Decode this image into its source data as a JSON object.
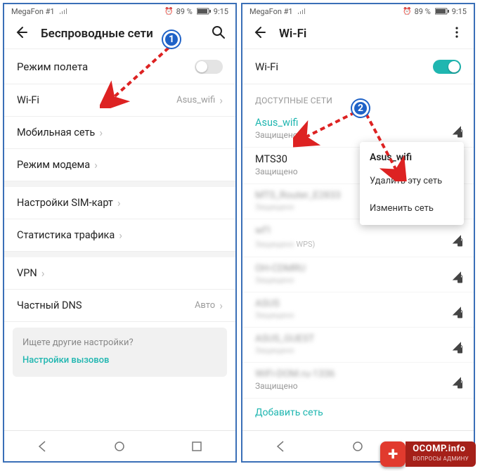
{
  "status": {
    "carrier": "MegaFon #1",
    "battery_pct": "89 %",
    "time": "9:15",
    "alarm_icon": "⏰"
  },
  "left": {
    "title": "Беспроводные сети",
    "rows": {
      "airplane": "Режим полета",
      "wifi": "Wi-Fi",
      "wifi_value": "Asus_wifi",
      "mobile": "Мобильная сеть",
      "tether": "Режим модема",
      "sim": "Настройки SIM-карт",
      "traffic": "Статистика трафика",
      "vpn": "VPN",
      "dns": "Частный DNS",
      "dns_value": "Авто"
    },
    "hint": {
      "q": "Ищете другие настройки?",
      "link": "Настройки вызовов"
    }
  },
  "right": {
    "title": "Wi-Fi",
    "wifi_toggle_label": "Wi-Fi",
    "section": "ДОСТУПНЫЕ СЕТИ",
    "networks": [
      {
        "name": "Asus_wifi",
        "sub": "Защищено",
        "active": true
      },
      {
        "name": "MTS30",
        "sub": "Защищено",
        "active": false
      },
      {
        "name": "MTS_Router_E2833",
        "sub": "Защищено",
        "active": false,
        "blur": true
      },
      {
        "name": "wf1",
        "sub": "Защищено WPS)",
        "active": false,
        "blur": true,
        "wps": " WPS)"
      },
      {
        "name": "OH-CDMRU",
        "sub": "Защищено",
        "active": false,
        "blur": true
      },
      {
        "name": "ASUS",
        "sub": "Защищено",
        "active": false,
        "blur": true
      },
      {
        "name": "ASUS_GUEST",
        "sub": "Защищено",
        "active": false,
        "blur": true
      },
      {
        "name": "WiFi-DOM.ru-1336",
        "sub": "Защищено",
        "active": false,
        "blur": false
      }
    ],
    "context_menu": {
      "title": "Asus_wifi",
      "delete": "Удалить эту сеть",
      "modify": "Изменить сеть"
    },
    "add_network": "Добавить сеть"
  },
  "watermark": {
    "line1": "OCOMP.info",
    "line2": "ВОПРОСЫ АДМИНУ"
  },
  "badges": {
    "b1": "1",
    "b2": "2"
  }
}
